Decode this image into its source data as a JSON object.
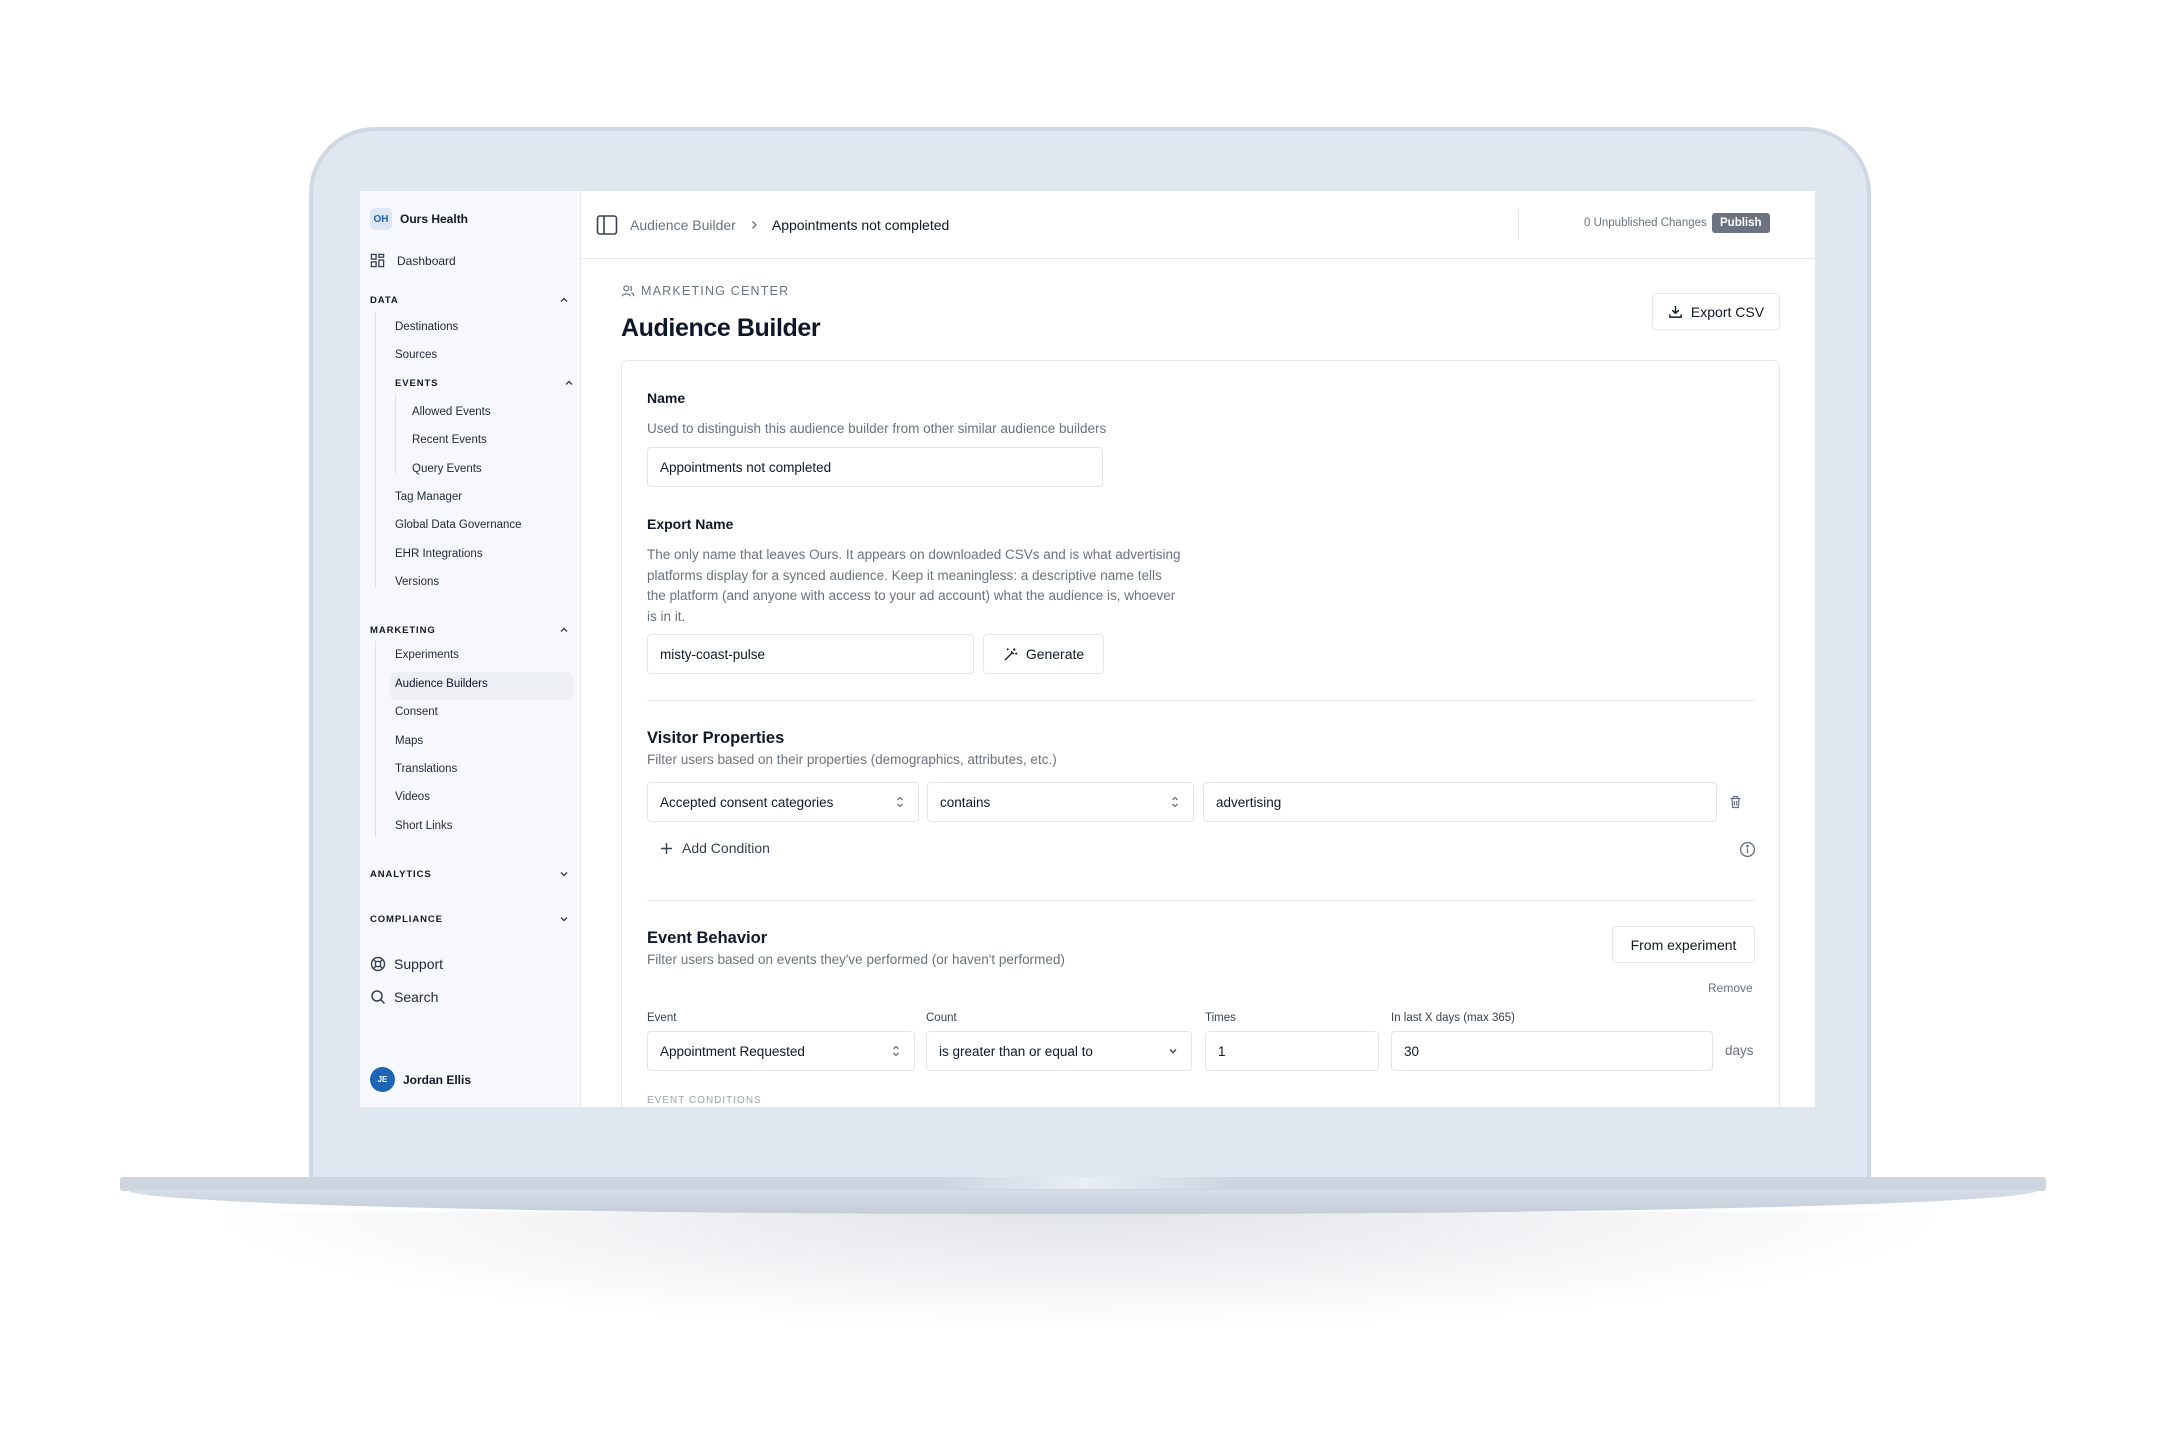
{
  "org": {
    "initials": "OH",
    "name": "Ours Health"
  },
  "nav": {
    "dashboard": "Dashboard",
    "data": {
      "title": "DATA",
      "items": [
        "Destinations",
        "Sources"
      ],
      "events": {
        "title": "EVENTS",
        "items": [
          "Allowed Events",
          "Recent Events",
          "Query Events"
        ]
      },
      "items_after": [
        "Tag Manager",
        "Global Data Governance",
        "EHR Integrations",
        "Versions"
      ]
    },
    "marketing": {
      "title": "MARKETING",
      "items": [
        "Experiments",
        "Audience Builders",
        "Consent",
        "Maps",
        "Translations",
        "Videos",
        "Short Links"
      ],
      "active": "Audience Builders"
    },
    "analytics": "ANALYTICS",
    "compliance": "COMPLIANCE",
    "support": "Support",
    "search": "Search"
  },
  "user": {
    "initials": "JE",
    "name": "Jordan Ellis"
  },
  "header": {
    "breadcrumb_parent": "Audience Builder",
    "breadcrumb_current": "Appointments not completed",
    "unpublished": "0 Unpublished Changes",
    "publish": "Publish"
  },
  "page": {
    "section_label": "MARKETING CENTER",
    "title": "Audience Builder",
    "export_csv": "Export CSV"
  },
  "form": {
    "name": {
      "label": "Name",
      "description": "Used to distinguish this audience builder from other similar audience builders",
      "value": "Appointments not completed"
    },
    "export_name": {
      "label": "Export Name",
      "description_lines": [
        "The only name that leaves Ours. It appears on downloaded CSVs and is what advertising",
        "platforms display for a synced audience. Keep it meaningless: a descriptive name tells",
        "the platform (and anyone with access to your ad account) what the audience is, whoever",
        "is in it."
      ],
      "value": "misty-coast-pulse",
      "generate": "Generate"
    },
    "visitor_properties": {
      "title": "Visitor Properties",
      "description": "Filter users based on their properties (demographics, attributes, etc.)",
      "condition": {
        "property": "Accepted consent categories",
        "operator": "contains",
        "value": "advertising"
      },
      "add_condition": "Add Condition"
    },
    "event_behavior": {
      "title": "Event Behavior",
      "description": "Filter users based on events they've performed (or haven't performed)",
      "from_experiment": "From experiment",
      "remove": "Remove",
      "labels": {
        "event": "Event",
        "count": "Count",
        "times": "Times",
        "days": "In last X days (max 365)"
      },
      "values": {
        "event": "Appointment Requested",
        "count": "is greater than or equal to",
        "times": "1",
        "days": "30"
      },
      "days_suffix": "days",
      "event_conditions": "EVENT CONDITIONS"
    }
  }
}
